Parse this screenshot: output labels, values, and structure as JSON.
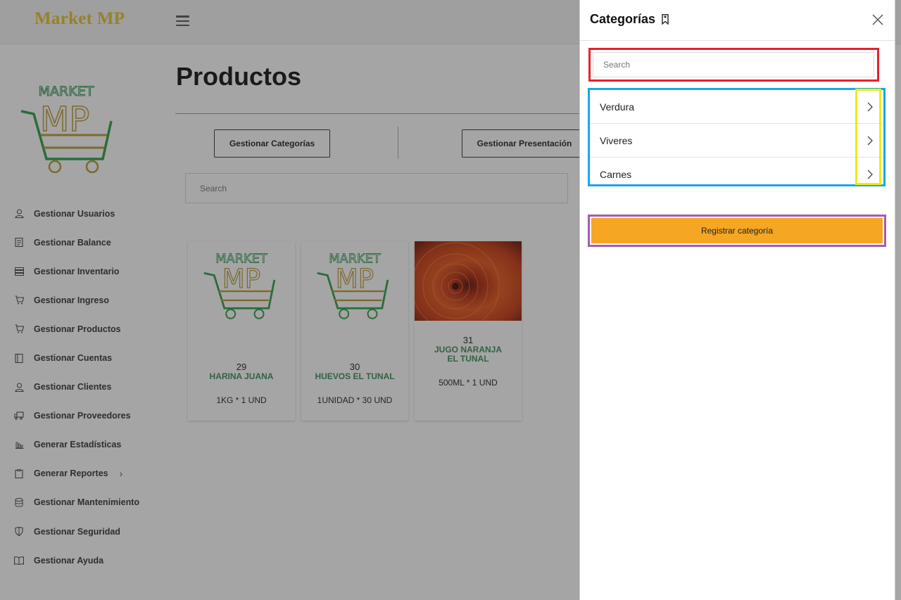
{
  "topbar": {
    "brand": "Market MP"
  },
  "sidebar": {
    "logo_text_1": "MARKET",
    "logo_text_2": "MP",
    "items": [
      {
        "label": "Gestionar Usuarios",
        "icon": "user-icon"
      },
      {
        "label": "Gestionar Balance",
        "icon": "ledger-icon"
      },
      {
        "label": "Gestionar Inventario",
        "icon": "list-icon"
      },
      {
        "label": "Gestionar Ingreso",
        "icon": "cart-icon"
      },
      {
        "label": "Gestionar Productos",
        "icon": "cart-icon"
      },
      {
        "label": "Gestionar Cuentas",
        "icon": "book-icon"
      },
      {
        "label": "Gestionar Clientes",
        "icon": "user-icon"
      },
      {
        "label": "Gestionar Proveedores",
        "icon": "truck-icon"
      },
      {
        "label": "Generar Estadísticas",
        "icon": "bar-chart-icon"
      },
      {
        "label": "Generar Reportes",
        "icon": "clipboard-icon"
      },
      {
        "label": "Gestionar Mantenimiento",
        "icon": "database-icon"
      },
      {
        "label": "Gestionar Seguridad",
        "icon": "shield-icon"
      },
      {
        "label": "Gestionar Ayuda",
        "icon": "book-open-icon"
      }
    ]
  },
  "main": {
    "title": "Productos",
    "btn_categorias": "Gestionar Categorías",
    "btn_presentacion": "Gestionar Presentación",
    "search_placeholder": "Search",
    "products": [
      {
        "id": "29",
        "name": "HARINA JUANA",
        "qty": "1KG * 1 UND",
        "image": "market-mp-logo"
      },
      {
        "id": "30",
        "name": "HUEVOS EL TUNAL",
        "qty": "1UNIDAD * 30 UND",
        "image": "market-mp-logo"
      },
      {
        "id": "31",
        "name_line1": "JUGO NARANJA",
        "name_line2": "EL TUNAL",
        "qty": "500ML * 1 UND",
        "image": "orange-flower-photo"
      }
    ]
  },
  "panel": {
    "title": "Categorías",
    "search_placeholder": "Search",
    "categories": [
      {
        "label": "Verdura"
      },
      {
        "label": "Viveres"
      },
      {
        "label": "Carnes"
      }
    ],
    "register_label": "Registrar categoría"
  },
  "colors": {
    "brand": "#e5c32a",
    "accent_orange": "#f5a623",
    "product_name": "#3b8a55",
    "highlight_red": "#e8202a",
    "highlight_blue": "#1aa6e8",
    "highlight_yellow": "#f2ea0d",
    "highlight_purple": "#a45bb6"
  }
}
